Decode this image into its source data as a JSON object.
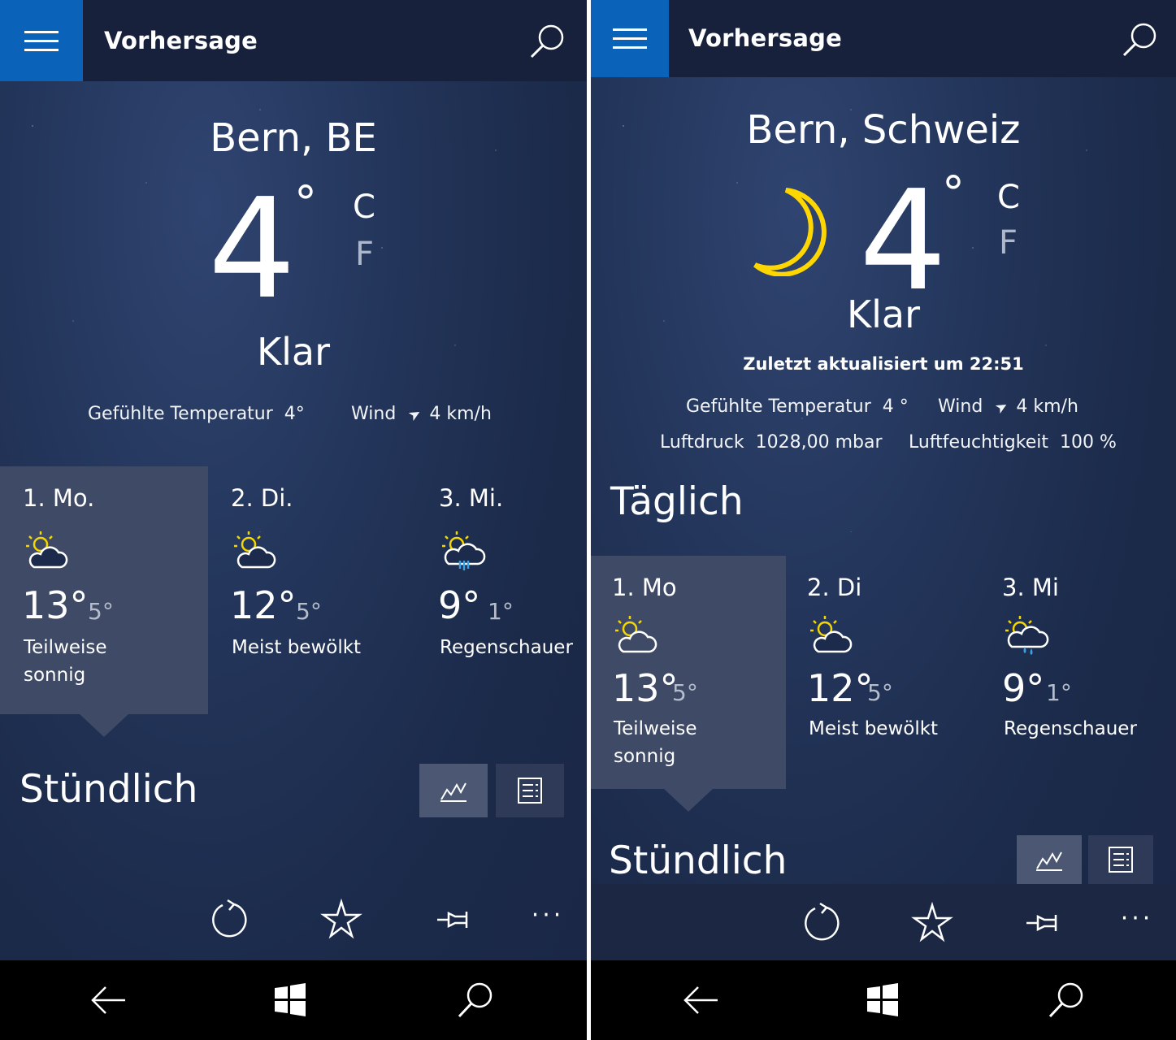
{
  "left": {
    "app_title": "Vorhersage",
    "city": "Bern, BE",
    "temperature": "4",
    "degree": "°",
    "unit_c": "C",
    "unit_f": "F",
    "condition": "Klar",
    "feels_label": "Gefühlte Temperatur",
    "feels_value": "4°",
    "wind_label": "Wind",
    "wind_value": "4 km/h",
    "days": [
      {
        "label": "1. Mo.",
        "high": "13°",
        "low": "5°",
        "cond1": "Teilweise",
        "cond2": "sonnig",
        "icon": "partly-sunny-icon"
      },
      {
        "label": "2. Di.",
        "high": "12°",
        "low": "5°",
        "cond1": "Meist bewölkt",
        "cond2": "",
        "icon": "mostly-cloudy-icon"
      },
      {
        "label": "3. Mi.",
        "high": "9°",
        "low": "1°",
        "cond1": "Regenschauer",
        "cond2": "",
        "icon": "rain-showers-icon"
      }
    ],
    "hourly_title": "Stündlich"
  },
  "right": {
    "app_title": "Vorhersage",
    "city": "Bern, Schweiz",
    "temperature": "4",
    "degree": "°",
    "unit_c": "C",
    "unit_f": "F",
    "condition": "Klar",
    "updated": "Zuletzt aktualisiert um 22:51",
    "feels_label": "Gefühlte Temperatur",
    "feels_value": "4 °",
    "wind_label": "Wind",
    "wind_value": "4 km/h",
    "pressure_label": "Luftdruck",
    "pressure_value": "1028,00 mbar",
    "humidity_label": "Luftfeuchtigkeit",
    "humidity_value": "100 %",
    "daily_title": "Täglich",
    "days": [
      {
        "label": "1. Mo",
        "high": "13°",
        "low": "5°",
        "cond1": "Teilweise",
        "cond2": "sonnig",
        "icon": "partly-sunny-icon"
      },
      {
        "label": "2. Di",
        "high": "12°",
        "low": "5°",
        "cond1": "Meist bewölkt",
        "cond2": "",
        "icon": "mostly-cloudy-icon"
      },
      {
        "label": "3. Mi",
        "high": "9°",
        "low": "1°",
        "cond1": "Regenschauer",
        "cond2": "",
        "icon": "rain-showers-icon"
      }
    ],
    "hourly_title": "Stündlich"
  },
  "command_bar": {
    "more": "···"
  },
  "colors": {
    "accent": "#0a63b8",
    "sun": "#f4d600",
    "moon": "#ffd700",
    "rain": "#3aa0e8"
  }
}
